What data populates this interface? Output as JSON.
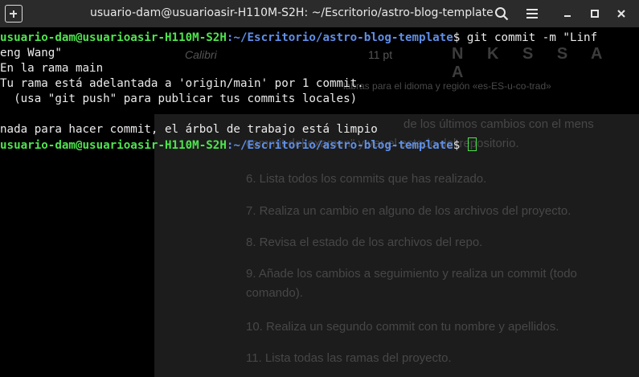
{
  "window": {
    "title": "usuario-dam@usuarioasir-H110M-S2H: ~/Escritorio/astro-blog-template",
    "new_tab_icon": "new-tab-icon",
    "search_icon": "search-icon",
    "menu_icon": "hamburger-menu-icon",
    "minimize_icon": "minimize-icon",
    "maximize_icon": "maximize-icon",
    "close_icon": "close-icon"
  },
  "terminal": {
    "prompt_user": "usuario-dam@usuarioasir-H110M-S2H",
    "prompt_path": ":~/Escritorio/astro-blog-template",
    "lines": {
      "cmd": "$ git commit -m \"Linf",
      "cmd_cont": "eng Wang\"",
      "l3": "En la rama main",
      "l4": "Tu rama está adelantada a 'origin/main' por 1 commit.",
      "l5": "  (usa \"git push\" para publicar tus commits locales)",
      "l6": "nada para hacer commit, el árbol de trabajo está limpio",
      "l7_suffix": "$ "
    }
  },
  "background_document": {
    "font_name": "Calibri",
    "font_size": "11 pt",
    "format_buttons": "N K S S A A",
    "spell_bar": "labras para el idioma y región «es-ES-u-co-trad»",
    "paragraphs": [
      "de los últimos cambios con el mens",
      "commit del examen\" y ver el estado del repositorio.",
      "6. Lista todos los commits que has realizado.",
      "7. Realiza un cambio en alguno de los archivos del proyecto.",
      "8. Revisa el estado de los archivos del repo.",
      "9. Añade los cambios a seguimiento y realiza un commit (todo",
      "comando).",
      "10. Realiza un segundo commit con tu nombre y apellidos.",
      "11. Lista todas las ramas del proyecto."
    ]
  },
  "colors": {
    "terminal_bg": "#000000",
    "prompt_user": "#4ee44e",
    "prompt_path": "#5f8fe8",
    "titlebar_bg": "#2b2b2b"
  }
}
